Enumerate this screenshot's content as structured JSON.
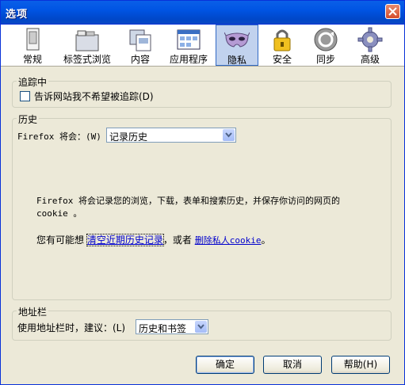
{
  "window": {
    "title": "选项"
  },
  "tabs": [
    {
      "label": "常规",
      "icon": "general-icon"
    },
    {
      "label": "标签式浏览",
      "icon": "tabs-icon"
    },
    {
      "label": "内容",
      "icon": "content-icon"
    },
    {
      "label": "应用程序",
      "icon": "applications-icon"
    },
    {
      "label": "隐私",
      "icon": "privacy-mask-icon",
      "selected": true
    },
    {
      "label": "安全",
      "icon": "lock-icon"
    },
    {
      "label": "同步",
      "icon": "sync-icon"
    },
    {
      "label": "高级",
      "icon": "gear-icon"
    }
  ],
  "tracking": {
    "title": "追踪中",
    "dnt_label": "告诉网站我不希望被追踪(D)",
    "dnt_checked": false
  },
  "history": {
    "title": "历史",
    "will_label": "Firefox 将会：(W)",
    "will_value": "记录历史",
    "description_line1": "Firefox 将会记录您的浏览，下载，表单和搜索历史，并保存你访问的网页的",
    "description_line2": "cookie 。",
    "maybe_prefix": "您有可能想",
    "clear_link": "清空近期历史记录",
    "or_text": "，或者",
    "remove_cookie_link": "删除私人cookie",
    "end_punct": "。"
  },
  "locationbar": {
    "title": "地址栏",
    "suggest_label": "使用地址栏时，建议：(L)",
    "suggest_value": "历史和书签"
  },
  "buttons": {
    "ok": "确定",
    "cancel": "取消",
    "help": "帮助(H)"
  },
  "colors": {
    "titlebar": "#0054e3",
    "selected_tab": "#c1d2ee",
    "dialog_bg": "#ece9d8",
    "link": "#0000cc"
  }
}
